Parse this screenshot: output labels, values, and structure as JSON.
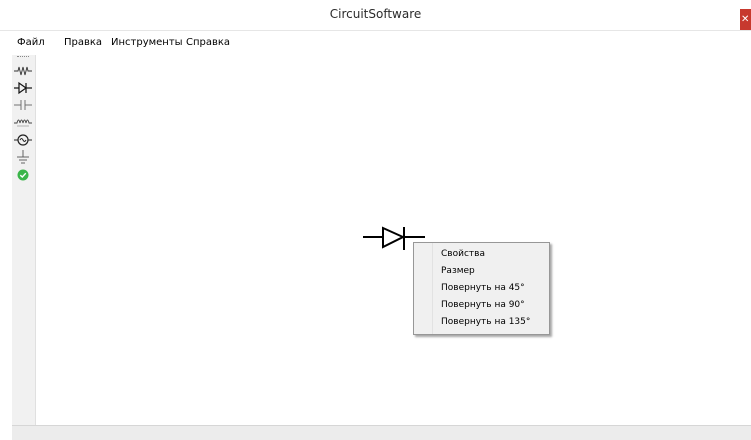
{
  "window": {
    "title": "CircuitSoftware",
    "close_symbol": "✕"
  },
  "menubar": {
    "items": [
      {
        "label": "Файл"
      },
      {
        "label": "Правка"
      },
      {
        "label": "Инструменты"
      },
      {
        "label": "Справка"
      }
    ]
  },
  "toolbar": {
    "tools": [
      {
        "icon": "resistor-icon"
      },
      {
        "icon": "diode-icon"
      },
      {
        "icon": "capacitor-icon"
      },
      {
        "icon": "inductor-icon"
      },
      {
        "icon": "lamp-icon"
      },
      {
        "icon": "ground-icon"
      },
      {
        "icon": "check-icon"
      }
    ]
  },
  "canvas": {
    "components": [
      {
        "type": "diode",
        "icon": "diode-symbol-icon"
      }
    ]
  },
  "context_menu": {
    "items": [
      {
        "label": "Свойства"
      },
      {
        "label": "Размер"
      },
      {
        "label": "Повернуть на 45°"
      },
      {
        "label": "Повернуть на 90°"
      },
      {
        "label": "Повернуть на 135°"
      }
    ]
  },
  "colors": {
    "close_button": "#c7392e",
    "check_icon": "#3bb54a",
    "toolbar_bg": "#f1f1f1",
    "menu_bg": "#f0f0f0"
  }
}
